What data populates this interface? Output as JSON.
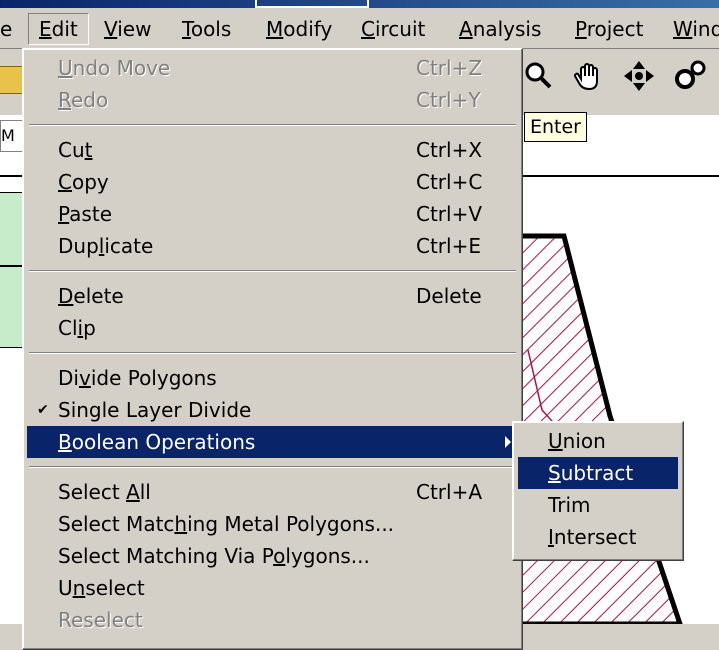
{
  "menubar": {
    "items": [
      {
        "pre": "",
        "ul": "",
        "post": "e"
      },
      {
        "pre": "",
        "ul": "E",
        "post": "dit"
      },
      {
        "pre": "",
        "ul": "V",
        "post": "iew"
      },
      {
        "pre": "",
        "ul": "T",
        "post": "ools"
      },
      {
        "pre": "",
        "ul": "M",
        "post": "odify"
      },
      {
        "pre": "",
        "ul": "C",
        "post": "ircuit"
      },
      {
        "pre": "",
        "ul": "A",
        "post": "nalysis"
      },
      {
        "pre": "",
        "ul": "P",
        "post": "roject"
      },
      {
        "pre": "",
        "ul": "W",
        "post": "ind"
      }
    ]
  },
  "toolbar": {
    "icons": [
      "zoom-icon",
      "hand-pan-icon",
      "move-arrows-icon",
      "settings-icon"
    ]
  },
  "tooltip": {
    "text": "Enter"
  },
  "tab_fragment": {
    "text": "M"
  },
  "edit_menu": {
    "items": [
      {
        "pre": "",
        "ul": "U",
        "post": "ndo Move",
        "shortcut": "Ctrl+Z",
        "disabled": true
      },
      {
        "pre": "",
        "ul": "R",
        "post": "edo",
        "shortcut": "Ctrl+Y",
        "disabled": true
      },
      {
        "pre": "Cu",
        "ul": "t",
        "post": "",
        "shortcut": "Ctrl+X"
      },
      {
        "pre": "",
        "ul": "C",
        "post": "opy",
        "shortcut": "Ctrl+C"
      },
      {
        "pre": "",
        "ul": "P",
        "post": "aste",
        "shortcut": "Ctrl+V"
      },
      {
        "pre": "Dup",
        "ul": "l",
        "post": "icate",
        "shortcut": "Ctrl+E"
      },
      {
        "pre": "",
        "ul": "D",
        "post": "elete",
        "shortcut": "Delete"
      },
      {
        "pre": "Cl",
        "ul": "i",
        "post": "p",
        "shortcut": ""
      },
      {
        "pre": "Di",
        "ul": "v",
        "post": "ide Polygons",
        "shortcut": ""
      },
      {
        "pre": "Single Layer Di",
        "ul": "",
        "post": "vide",
        "shortcut": "",
        "checked": true
      },
      {
        "pre": "",
        "ul": "B",
        "post": "oolean Operations",
        "shortcut": "",
        "submenu": true,
        "highlight": true
      },
      {
        "pre": "Select ",
        "ul": "A",
        "post": "ll",
        "shortcut": "Ctrl+A"
      },
      {
        "pre": "Select Matc",
        "ul": "h",
        "post": "ing Metal Polygons...",
        "shortcut": ""
      },
      {
        "pre": "Select Matching Via P",
        "ul": "o",
        "post": "lygons...",
        "shortcut": ""
      },
      {
        "pre": "U",
        "ul": "n",
        "post": "select",
        "shortcut": ""
      },
      {
        "pre": "Reselect",
        "ul": "",
        "post": "",
        "shortcut": "",
        "disabled": true
      }
    ]
  },
  "boolean_submenu": {
    "items": [
      {
        "pre": "",
        "ul": "U",
        "post": "nion"
      },
      {
        "pre": "",
        "ul": "S",
        "post": "ubtract",
        "highlight": true
      },
      {
        "pre": "",
        "ul": "",
        "post": "Trim"
      },
      {
        "pre": "",
        "ul": "I",
        "post": "ntersect"
      }
    ]
  },
  "colors": {
    "menu_bg": "#d4d0c8",
    "highlight": "#0a246a",
    "tooltip_bg": "#ffffe1",
    "hatch": "#b0104a",
    "green_panel": "#c7ecc9"
  }
}
